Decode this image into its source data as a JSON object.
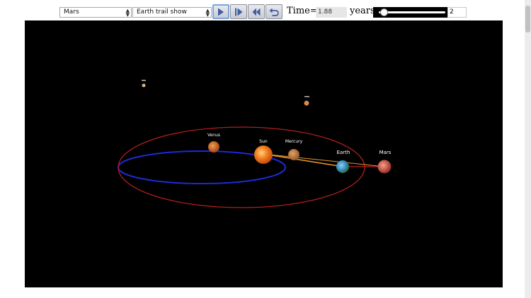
{
  "controls": {
    "target_select": "Mars",
    "trail_select": "Earth trail show",
    "time_label": "Time=",
    "time_value": "1.88",
    "years_label": "years",
    "speed_value": "2",
    "speed_level_fraction": 0.05
  },
  "buttons": {
    "play": "play-icon",
    "step": "step-forward-icon",
    "rewind": "rewind-icon",
    "reset": "reset-icon"
  },
  "planets": {
    "sun": "Sun",
    "venus": "Venus",
    "mercury": "Mercury",
    "earth": "Earth",
    "mars": "Mars"
  },
  "colors": {
    "scene_background": "#000000",
    "earth_orbit": "#1c2bd8",
    "mars_orbit": "#b11e1e",
    "line_of_sight": "#e8962e",
    "sun": "#f07a1c",
    "earth": "#3a8ec4",
    "mars": "#c75a4a"
  }
}
